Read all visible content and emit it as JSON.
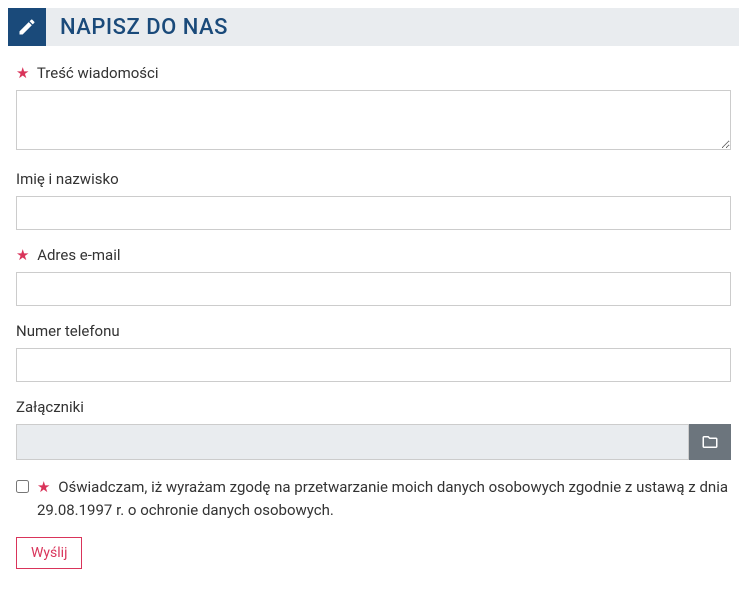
{
  "header": {
    "title": "NAPISZ DO NAS"
  },
  "form": {
    "message": {
      "label": "Treść wiadomości",
      "required": true,
      "value": ""
    },
    "name": {
      "label": "Imię i nazwisko",
      "required": false,
      "value": ""
    },
    "email": {
      "label": "Adres e-mail",
      "required": true,
      "value": ""
    },
    "phone": {
      "label": "Numer telefonu",
      "required": false,
      "value": ""
    },
    "attachments": {
      "label": "Załączniki",
      "required": false,
      "value": ""
    },
    "consent": {
      "label": "Oświadczam, iż wyrażam zgodę na przetwarzanie moich danych osobowych zgodnie z ustawą z dnia 29.08.1997 r. o ochronie danych osobowych.",
      "required": true,
      "checked": false
    },
    "submit": {
      "label": "Wyślij"
    }
  },
  "required_marker": "★"
}
